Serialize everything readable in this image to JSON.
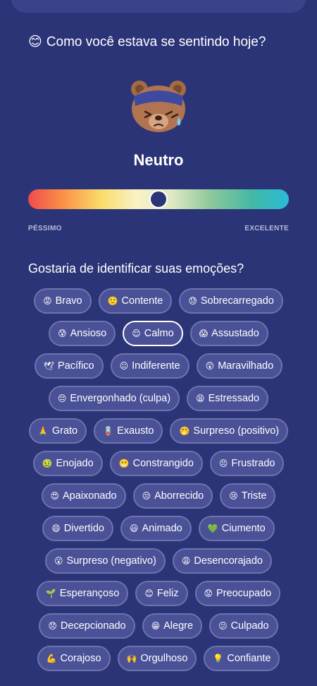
{
  "question": {
    "emoji": "😊",
    "text": "Como você estava se sentindo hoje?"
  },
  "mood": {
    "label": "Neutro",
    "value_fraction": 0.5
  },
  "scale": {
    "min_label": "PÉSSIMO",
    "max_label": "EXCELENTE"
  },
  "identify": {
    "text": "Gostaria de identificar suas emoções?"
  },
  "emotions": [
    [
      {
        "emoji": "😡",
        "label": "Bravo"
      },
      {
        "emoji": "🙂",
        "label": "Contente"
      },
      {
        "emoji": "😓",
        "label": "Sobrecarregado"
      }
    ],
    [
      {
        "emoji": "😰",
        "label": "Ansioso"
      },
      {
        "emoji": "😌",
        "label": "Calmo",
        "selected": true
      },
      {
        "emoji": "😱",
        "label": "Assustado"
      }
    ],
    [
      {
        "emoji": "🕊",
        "label": "Pacífico"
      },
      {
        "emoji": "😐",
        "label": "Indiferente"
      },
      {
        "emoji": "😲",
        "label": "Maravilhado"
      }
    ],
    [
      {
        "emoji": "😔",
        "label": "Envergonhado (culpa)"
      },
      {
        "emoji": "😫",
        "label": "Estressado"
      }
    ],
    [
      {
        "emoji": "🙏",
        "label": "Grato"
      },
      {
        "emoji": "🪫",
        "label": "Exausto"
      },
      {
        "emoji": "🤭",
        "label": "Surpreso (positivo)"
      }
    ],
    [
      {
        "emoji": "🤢",
        "label": "Enojado"
      },
      {
        "emoji": "😬",
        "label": "Constrangido"
      },
      {
        "emoji": "😣",
        "label": "Frustrado"
      }
    ],
    [
      {
        "emoji": "😍",
        "label": "Apaixonado"
      },
      {
        "emoji": "😒",
        "label": "Aborrecido"
      },
      {
        "emoji": "😢",
        "label": "Triste"
      }
    ],
    [
      {
        "emoji": "😄",
        "label": "Divertido"
      },
      {
        "emoji": "😃",
        "label": "Animado"
      },
      {
        "emoji": "💚",
        "label": "Ciumento"
      }
    ],
    [
      {
        "emoji": "😮",
        "label": "Surpreso (negativo)"
      },
      {
        "emoji": "😩",
        "label": "Desencorajado"
      }
    ],
    [
      {
        "emoji": "🌱",
        "label": "Esperançoso"
      },
      {
        "emoji": "😊",
        "label": "Feliz"
      },
      {
        "emoji": "😟",
        "label": "Preocupado"
      }
    ],
    [
      {
        "emoji": "😞",
        "label": "Decepcionado"
      },
      {
        "emoji": "😁",
        "label": "Alegre"
      },
      {
        "emoji": "😕",
        "label": "Culpado"
      }
    ],
    [
      {
        "emoji": "💪",
        "label": "Corajoso"
      },
      {
        "emoji": "🙌",
        "label": "Orgulhoso"
      },
      {
        "emoji": "💡",
        "label": "Confiante"
      }
    ]
  ],
  "colors": {
    "background": "#2b3477",
    "chip_bg": "#4a5197",
    "chip_border": "#6d74ad",
    "selected_border": "#ffffff"
  }
}
